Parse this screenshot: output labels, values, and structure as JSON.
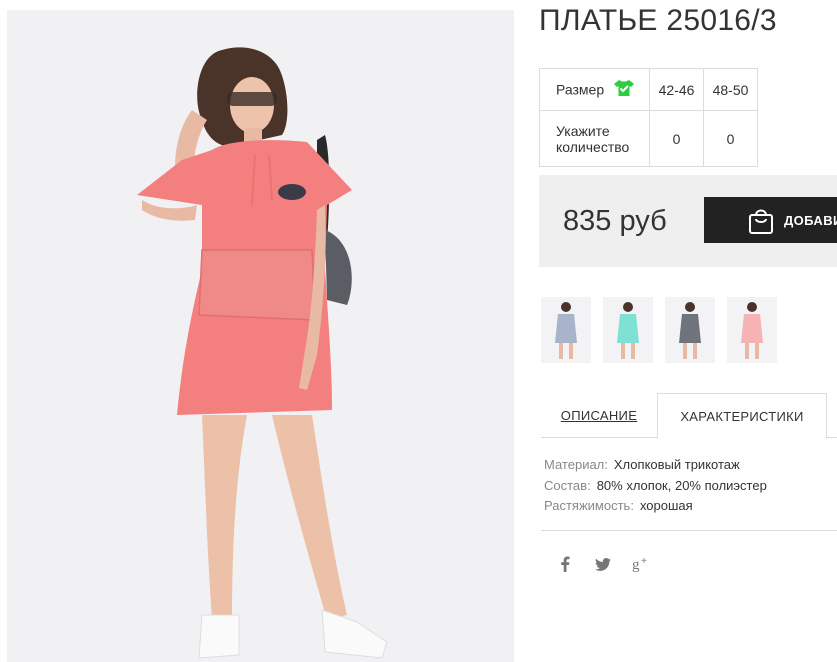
{
  "product": {
    "title": "ПЛАТЬЕ 25016/3"
  },
  "size_table": {
    "size_label": "Размер",
    "sizes": [
      "42-46",
      "48-50"
    ],
    "qty_label_line1": "Укажите",
    "qty_label_line2": "количество",
    "quantities": [
      "0",
      "0"
    ]
  },
  "buy": {
    "price": "835 руб",
    "add_button_label": "ДОБАВИТЬ"
  },
  "tabs": {
    "description": "ОПИСАНИЕ",
    "specs": "ХАРАКТЕРИСТИКИ"
  },
  "specs": [
    {
      "key": "Материал:",
      "value": "Хлопковый трикотаж"
    },
    {
      "key": "Состав:",
      "value": "80% хлопок, 20% полиэстер"
    },
    {
      "key": "Растяжимость:",
      "value": "хорошая"
    }
  ],
  "colors": {
    "dress_main": "#f47f7f",
    "thumb_colors": [
      "#a7b4c9",
      "#7fe0d4",
      "#6f737b",
      "#f5b3b6"
    ],
    "button_bg": "#222222",
    "buy_box_bg": "#efefef",
    "size_icon": "#2ecc40"
  },
  "icons": {
    "size_icon": "tshirt-check-icon",
    "button_icon": "shopping-bag-icon",
    "social": [
      "facebook-icon",
      "twitter-icon",
      "google-plus-icon"
    ]
  }
}
